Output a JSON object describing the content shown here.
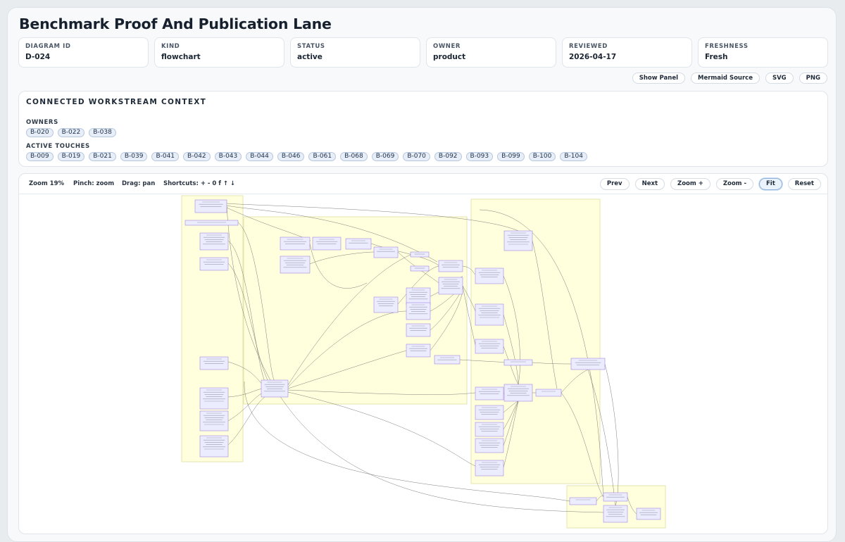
{
  "title": "Benchmark Proof And Publication Lane",
  "meta": [
    {
      "key": "DIAGRAM ID",
      "value": "D-024"
    },
    {
      "key": "KIND",
      "value": "flowchart"
    },
    {
      "key": "STATUS",
      "value": "active"
    },
    {
      "key": "OWNER",
      "value": "product"
    },
    {
      "key": "REVIEWED",
      "value": "2026-04-17"
    },
    {
      "key": "FRESHNESS",
      "value": "Fresh"
    }
  ],
  "actions": [
    "Show Panel",
    "Mermaid Source",
    "SVG",
    "PNG"
  ],
  "context": {
    "title": "CONNECTED WORKSTREAM CONTEXT",
    "owners_label": "OWNERS",
    "owners": [
      "B-020",
      "B-022",
      "B-038"
    ],
    "touches_label": "ACTIVE TOUCHES",
    "touches": [
      "B-009",
      "B-019",
      "B-021",
      "B-039",
      "B-041",
      "B-042",
      "B-043",
      "B-044",
      "B-046",
      "B-061",
      "B-068",
      "B-069",
      "B-070",
      "B-092",
      "B-093",
      "B-099",
      "B-100",
      "B-104"
    ]
  },
  "viewer": {
    "zoom": "Zoom 19%",
    "pinch": "Pinch: zoom",
    "drag": "Drag: pan",
    "shortcuts": "Shortcuts: + - 0 f ↑ ↓",
    "buttons": [
      "Prev",
      "Next",
      "Zoom +",
      "Zoom -",
      "Fit",
      "Reset"
    ],
    "active_button": "Fit"
  },
  "colors": {
    "cluster_fill": "#ffffde",
    "cluster_stroke": "#dede9e",
    "node_fill": "#ececff",
    "node_stroke": "#9370db",
    "edge": "#555555"
  }
}
